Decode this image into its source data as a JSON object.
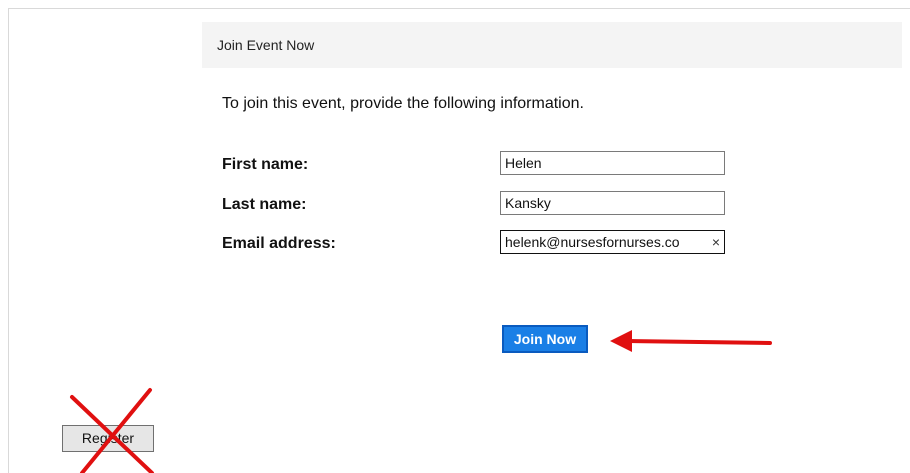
{
  "header": {
    "title": "Join Event Now"
  },
  "form": {
    "intro": "To join this event, provide the following information.",
    "first_name_label": "First name:",
    "first_name_value": "Helen",
    "last_name_label": "Last name:",
    "last_name_value": "Kansky",
    "email_label": "Email address:",
    "email_value": "helenk@nursesfornurses.co",
    "clear_glyph": "×",
    "join_label": "Join Now"
  },
  "footer": {
    "register_label": "Register"
  },
  "annotations": {
    "arrow_color": "#e01010",
    "cross_color": "#e01010",
    "arrow_icon": "left-arrow-icon",
    "cross_icon": "cross-out-icon"
  },
  "colors": {
    "primary_button": "#1a7fe6",
    "header_background": "#f4f4f4"
  }
}
